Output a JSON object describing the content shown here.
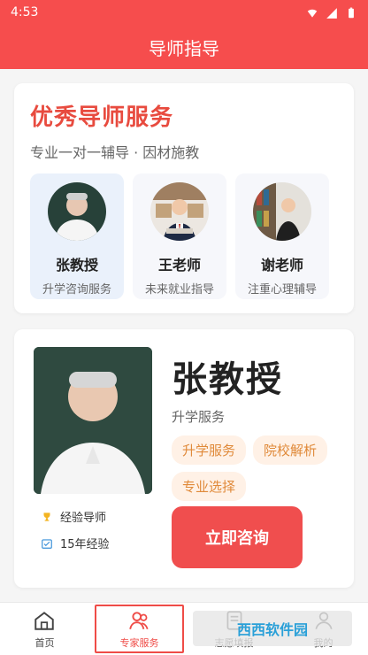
{
  "status": {
    "time": "4:53"
  },
  "appbar": {
    "title": "导师指导"
  },
  "intro": {
    "title": "优秀导师服务",
    "subtitle": "专业一对一辅导 · 因材施教",
    "mentors": [
      {
        "name": "张教授",
        "desc": "升学咨询服务"
      },
      {
        "name": "王老师",
        "desc": "未来就业指导"
      },
      {
        "name": "谢老师",
        "desc": "注重心理辅导"
      }
    ]
  },
  "profile": {
    "name": "张教授",
    "service_label": "升学服务",
    "tags": [
      "升学服务",
      "院校解析",
      "专业选择"
    ],
    "features": [
      "经验导师",
      "15年经验"
    ],
    "consult_button": "立即咨询"
  },
  "tabbar": {
    "items": [
      {
        "label": "首页"
      },
      {
        "label": "专家服务"
      },
      {
        "label": "志愿填报"
      },
      {
        "label": "我的"
      }
    ]
  },
  "watermark": {
    "text": "西西软件园"
  },
  "colors": {
    "primary": "#f64d4d",
    "accent": "#e84b3f",
    "tag_bg": "#fff1e6",
    "tag_text": "#e08a3a"
  }
}
